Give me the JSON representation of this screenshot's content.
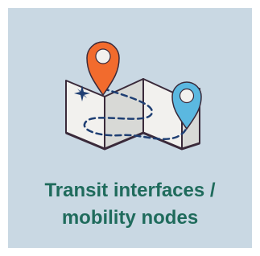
{
  "card": {
    "caption_line1": "Transit interfaces /",
    "caption_line2": "mobility nodes",
    "background_color": "#c9d8e3",
    "caption_color": "#1f6b5c"
  },
  "illustration": {
    "icons": [
      "folded-map-icon",
      "orange-location-pin-icon",
      "blue-location-pin-icon",
      "compass-star-icon",
      "dashed-route-icon"
    ],
    "colors": {
      "map_paper": "#f2f1ee",
      "map_shade": "#d8d9d6",
      "map_outline": "#3a2a3a",
      "pin_orange": "#f26b2d",
      "pin_blue": "#5bb8e0",
      "route": "#1f3f73"
    }
  }
}
